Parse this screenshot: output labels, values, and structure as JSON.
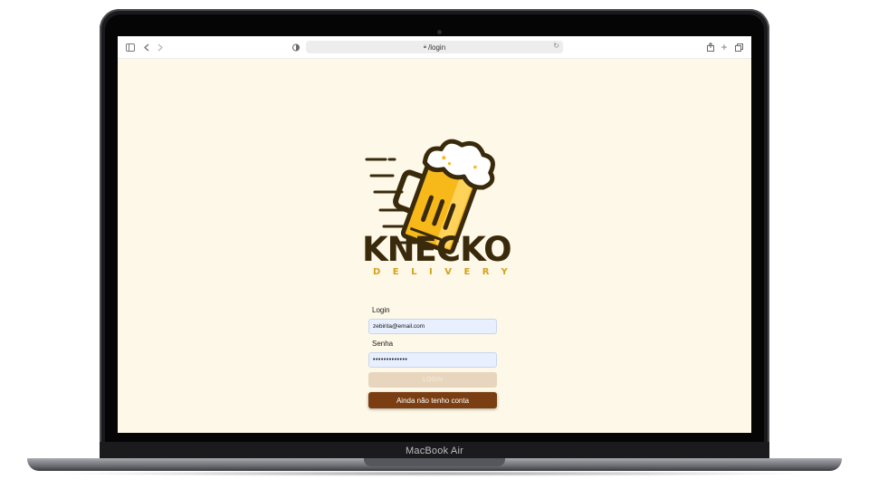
{
  "browser": {
    "address": "/login",
    "icons": [
      "sidebar-icon",
      "back-icon",
      "forward-icon",
      "shield-icon",
      "lock-icon",
      "reload-icon",
      "share-icon",
      "new-tab-icon",
      "tabs-icon"
    ]
  },
  "brand": {
    "title": "KNECKO",
    "subtitle": "DELIVERY"
  },
  "form": {
    "login_label": "Login",
    "login_value": "zebirita@email.com",
    "password_label": "Senha",
    "password_value": "•••••••••••••",
    "login_button": "LOGIN",
    "register_button": "Ainda não tenho conta"
  },
  "device": {
    "model": "MacBook Air"
  },
  "colors": {
    "page_background": "#fdf8e7",
    "brand_dark": "#3a2a0c",
    "brand_gold": "#d4a21a",
    "login_button_disabled": "#e8d5bd",
    "register_button": "#7a3e12",
    "input_background": "#e8efff"
  }
}
